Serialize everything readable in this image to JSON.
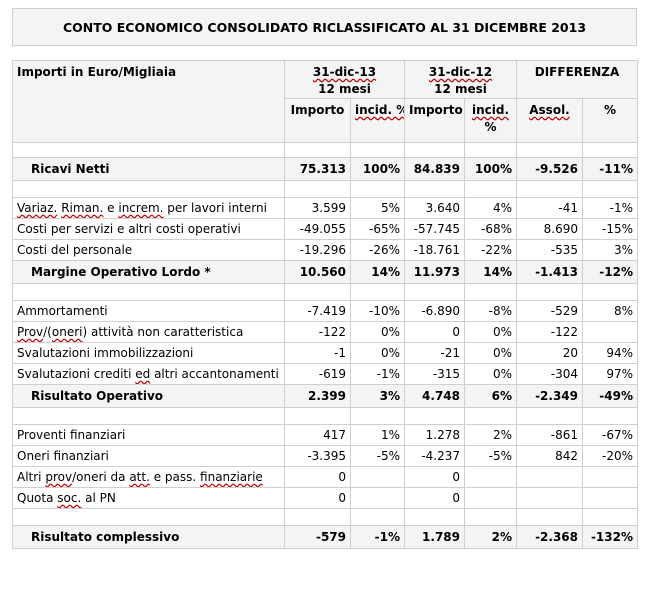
{
  "title": "CONTO ECONOMICO CONSOLIDATO RICLASSIFICATO AL 31 DICEMBRE 2013",
  "header": {
    "label": "Importi in Euro/Migliaia",
    "col1_date": "31-dic-13",
    "col1_period": "12 mesi",
    "col2_date": "31-dic-12",
    "col2_period": "12 mesi",
    "diff": "DIFFERENZA",
    "importo": "Importo",
    "incid": "incid. %",
    "incid2_a": "incid.",
    "incid2_b": "%",
    "assol": "Assol.",
    "pct": "%"
  },
  "ricavi": {
    "label": "Ricavi Netti",
    "v1": "75.313",
    "i1": "100%",
    "v2": "84.839",
    "i2": "100%",
    "d": "-9.526",
    "p": "-11%"
  },
  "group1": [
    {
      "label": "Variaz. Riman. e increm. per lavori interni",
      "v1": "3.599",
      "i1": "5%",
      "v2": "3.640",
      "i2": "4%",
      "d": "-41",
      "p": "-1%"
    },
    {
      "label": "Costi per servizi e altri costi operativi",
      "v1": "-49.055",
      "i1": "-65%",
      "v2": "-57.745",
      "i2": "-68%",
      "d": "8.690",
      "p": "-15%"
    },
    {
      "label": "Costi del personale",
      "v1": "-19.296",
      "i1": "-26%",
      "v2": "-18.761",
      "i2": "-22%",
      "d": "-535",
      "p": "3%"
    }
  ],
  "mol": {
    "label": "Margine Operativo Lordo *",
    "v1": "10.560",
    "i1": "14%",
    "v2": "11.973",
    "i2": "14%",
    "d": "-1.413",
    "p": "-12%"
  },
  "group2": [
    {
      "label": "Ammortamenti",
      "v1": "-7.419",
      "i1": "-10%",
      "v2": "-6.890",
      "i2": "-8%",
      "d": "-529",
      "p": "8%"
    },
    {
      "label": "Prov/(oneri) attività non caratteristica",
      "v1": "-122",
      "i1": "0%",
      "v2": "0",
      "i2": "0%",
      "d": "-122",
      "p": ""
    },
    {
      "label": "Svalutazioni immobilizzazioni",
      "v1": "-1",
      "i1": "0%",
      "v2": "-21",
      "i2": "0%",
      "d": "20",
      "p": "94%"
    },
    {
      "label": "Svalutazioni crediti ed altri accantonamenti",
      "v1": "-619",
      "i1": "-1%",
      "v2": "-315",
      "i2": "0%",
      "d": "-304",
      "p": "97%"
    }
  ],
  "ro": {
    "label": "Risultato Operativo",
    "v1": "2.399",
    "i1": "3%",
    "v2": "4.748",
    "i2": "6%",
    "d": "-2.349",
    "p": "-49%"
  },
  "group3": [
    {
      "label": "Proventi finanziari",
      "v1": "417",
      "i1": "1%",
      "v2": "1.278",
      "i2": "2%",
      "d": "-861",
      "p": "-67%"
    },
    {
      "label": "Oneri finanziari",
      "v1": "-3.395",
      "i1": "-5%",
      "v2": "-4.237",
      "i2": "-5%",
      "d": "842",
      "p": "-20%"
    },
    {
      "label": "Altri prov/oneri da att. e pass. finanziarie",
      "v1": "0",
      "i1": "",
      "v2": "0",
      "i2": "",
      "d": "",
      "p": ""
    },
    {
      "label": "Quota soc. al PN",
      "v1": "0",
      "i1": "",
      "v2": "0",
      "i2": "",
      "d": "",
      "p": ""
    }
  ],
  "totale": {
    "label": "Risultato complessivo",
    "v1": "-579",
    "i1": "-1%",
    "v2": "1.789",
    "i2": "2%",
    "d": "-2.368",
    "p": "-132%"
  }
}
